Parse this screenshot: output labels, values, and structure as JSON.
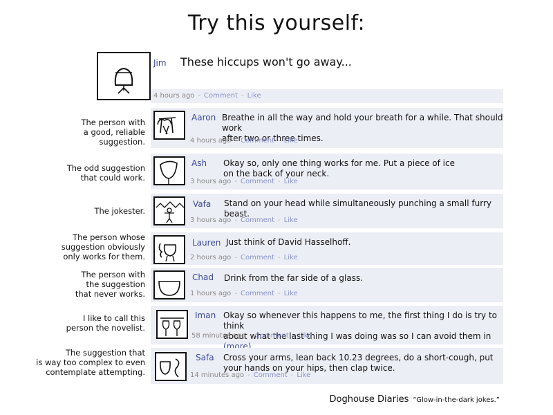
{
  "title": "Try this yourself:",
  "op": {
    "name": "Jim",
    "text": "These hiccups won't go away...",
    "time": "4 hours ago",
    "comment": "Comment",
    "like": "Like"
  },
  "replies": [
    {
      "name": "Aaron",
      "text": "Breathe in all the way and hold your breath for a while. That should work\nafter two or three times.",
      "time": "4 hours ago",
      "label": "The person with\na good, reliable\nsuggestion.",
      "more": ""
    },
    {
      "name": "Ash",
      "text": "Okay so, only one thing works for me. Put a piece of ice\non the back of your neck.",
      "time": "3 hours ago",
      "label": "The odd suggestion\nthat could work.",
      "more": ""
    },
    {
      "name": "Vafa",
      "text": "Stand on your head while simultaneously punching a small furry beast.",
      "time": "3 hours ago",
      "label": "The jokester.",
      "more": ""
    },
    {
      "name": "Lauren",
      "text": "Just think of David Hasselhoff.",
      "time": "2 hours ago",
      "label": "The person whose\nsuggestion obviously\nonly works for them.",
      "more": ""
    },
    {
      "name": "Chad",
      "text": "Drink from the far side of a glass.",
      "time": "1 hours ago",
      "label": "The person with\nthe suggestion\nthat never works.",
      "more": ""
    },
    {
      "name": "Iman",
      "text": "Okay so whenever this happens to me, the first thing I do is try to think\nabout what the last thing I was doing was so I can avoid them in ",
      "time": "58 minutes ago",
      "label": "I like to call this\nperson the novelist.",
      "more": "(more)"
    },
    {
      "name": "Safa",
      "text": "Cross your arms, lean back 10.23 degrees, do a short-cough, put\nyour hands on your hips, then clap twice.",
      "time": "14 minutes ago",
      "label": "The suggestion that\nis way too complex to even\ncontemplate attempting.",
      "more": ""
    }
  ],
  "actions": {
    "comment": "Comment",
    "like": "Like"
  },
  "footer": {
    "brand": "Doghouse Diaries",
    "tagline": "“Glow-in-the-dark jokes.”"
  }
}
